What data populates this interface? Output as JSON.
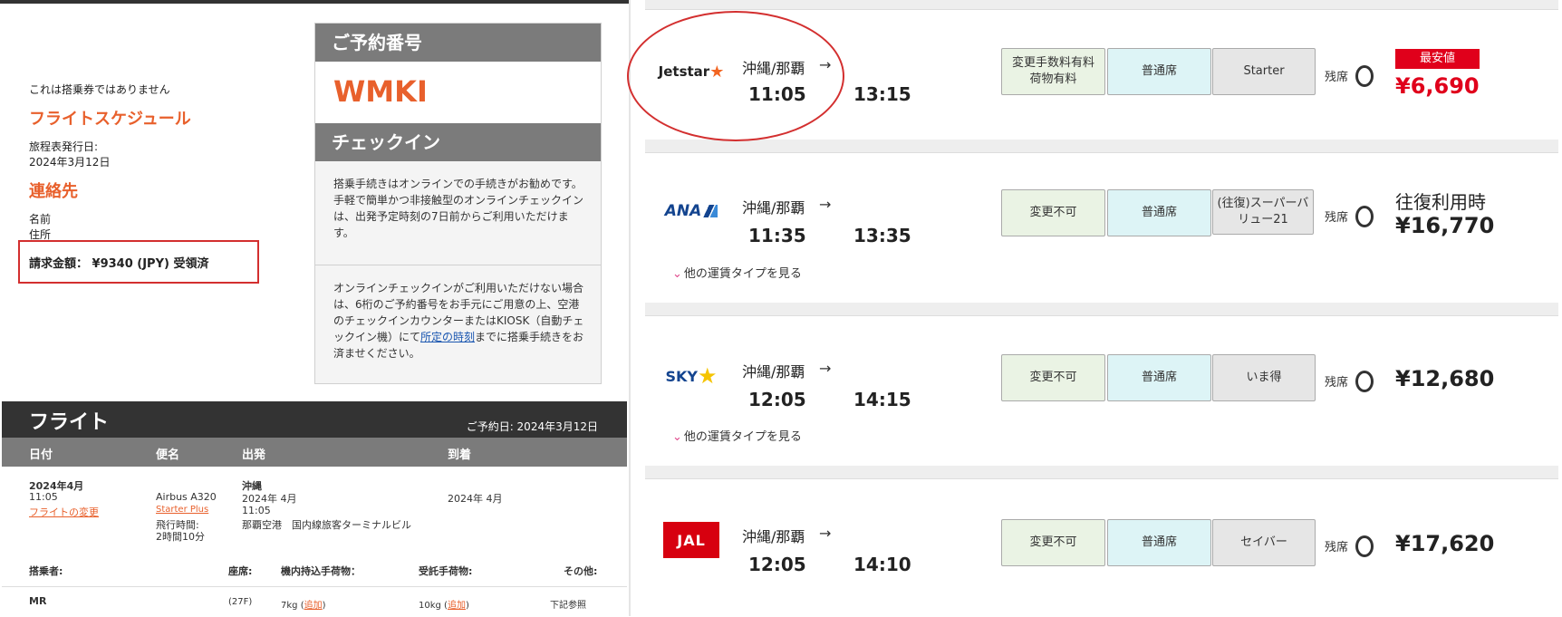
{
  "left": {
    "not_boarding_pass": "これは搭乗券ではありません",
    "schedule_title": "フライトスケジュール",
    "issue_label": "旅程表発行日:",
    "issue_date": "2024年3月12日",
    "contact_title": "連絡先",
    "name_label": "名前",
    "address_label": "住所",
    "billing": "請求金額： ¥9340 (JPY) 受領済",
    "booking_header": "ご予約番号",
    "booking_number": "WMKI",
    "checkin_header": "チェックイン",
    "checkin_text_1": "搭乗手続きはオンラインでの手続きがお勧めです。手軽で簡単かつ非接触型のオンラインチェックインは、出発予定時刻の7日前からご利用いただけます。",
    "checkin_text_2a": "オンラインチェックインがご利用いただけない場合は、6桁のご予約番号をお手元にご用意の上、空港のチェックインカウンターまたはKIOSK（自動チェックイン機）にて",
    "checkin_link": "所定の時刻",
    "checkin_text_2b": "までに搭乗手続きをお済ませください。",
    "flight_title": "フライト",
    "booking_date": "ご予約日: 2024年3月12日",
    "cols": {
      "date": "日付",
      "flight": "便名",
      "depart": "出発",
      "arrive": "到着"
    },
    "date_val": "2024年4月",
    "time_val": "11:05",
    "change_link": "フライトの変更",
    "aircraft": "Airbus A320",
    "fare_link": "Starter Plus",
    "duration_label": "飛行時間:",
    "duration": "2時間10分",
    "dep_city": "沖縄",
    "dep_date": "2024年 4月",
    "dep_time": "11:05",
    "dep_airport": "那覇空港　国内線旅客ターミナルビル",
    "arr_date": "2024年 4月",
    "pax_cols": {
      "pax": "搭乗者:",
      "seat": "座席:",
      "carry": "機内持込手荷物：",
      "checked": "受託手荷物:",
      "other": "その他:"
    },
    "pax_name": "MR",
    "pax_seat": "(27F)",
    "pax_carry": "7kg",
    "pax_checked": "10kg",
    "add_link": "追加",
    "pax_other": "下記参照"
  },
  "flights": [
    {
      "airline": "Jetstar",
      "logo_text": "Jetstar",
      "route": "沖縄/那覇",
      "dep": "11:05",
      "arr": "13:15",
      "fare1": "変更手数料有料\n荷物有料",
      "fare2": "普通席",
      "fare3": "Starter",
      "seats": "残席",
      "badge": "最安値",
      "price": "¥6,690",
      "price_color": "#e0001b"
    },
    {
      "airline": "ANA",
      "logo_text": "ANA",
      "route": "沖縄/那覇",
      "dep": "11:35",
      "arr": "13:35",
      "fare1": "変更不可",
      "fare2": "普通席",
      "fare3": "(往復)スーパーバリュー21",
      "seats": "残席",
      "note": "往復利用時",
      "price": "¥16,770",
      "more": "他の運賃タイプを見る"
    },
    {
      "airline": "SKY",
      "logo_text": "SKY",
      "route": "沖縄/那覇",
      "dep": "12:05",
      "arr": "14:15",
      "fare1": "変更不可",
      "fare2": "普通席",
      "fare3": "いま得",
      "seats": "残席",
      "price": "¥12,680",
      "more": "他の運賃タイプを見る"
    },
    {
      "airline": "JAL",
      "logo_text": "JAL",
      "route": "沖縄/那覇",
      "dep": "12:05",
      "arr": "14:10",
      "fare1": "変更不可",
      "fare2": "普通席",
      "fare3": "セイバー",
      "seats": "残席",
      "price": "¥17,620"
    }
  ]
}
